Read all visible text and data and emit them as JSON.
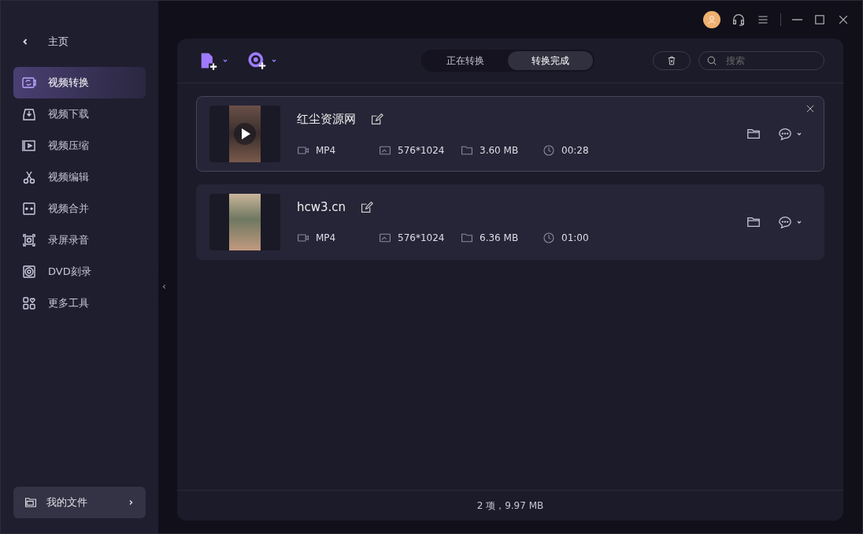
{
  "sidebar": {
    "back_label": "主页",
    "items": [
      {
        "kind": "convert",
        "label": "视频转换",
        "selected": true
      },
      {
        "kind": "download",
        "label": "视频下载",
        "selected": false
      },
      {
        "kind": "compress",
        "label": "视频压缩",
        "selected": false
      },
      {
        "kind": "edit",
        "label": "视频编辑",
        "selected": false
      },
      {
        "kind": "merge",
        "label": "视频合并",
        "selected": false
      },
      {
        "kind": "record",
        "label": "录屏录音",
        "selected": false
      },
      {
        "kind": "dvd",
        "label": "DVD刻录",
        "selected": false
      },
      {
        "kind": "more",
        "label": "更多工具",
        "selected": false
      }
    ],
    "files_button": "我的文件"
  },
  "tabs": [
    {
      "label": "正在转换",
      "selected": false
    },
    {
      "label": "转换完成",
      "selected": true
    }
  ],
  "search": {
    "placeholder": "搜索"
  },
  "files": [
    {
      "name": "红尘资源网",
      "format": "MP4",
      "resolution": "576*1024",
      "size": "3.60 MB",
      "duration": "00:28",
      "selected": true
    },
    {
      "name": "hcw3.cn",
      "format": "MP4",
      "resolution": "576*1024",
      "size": "6.36 MB",
      "duration": "01:00",
      "selected": false
    }
  ],
  "status_bar": "2 项，9.97 MB"
}
